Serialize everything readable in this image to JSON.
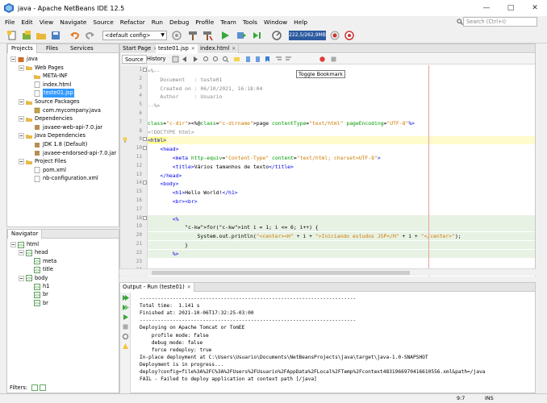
{
  "window": {
    "title": "java - Apache NetBeans IDE 12.5"
  },
  "menu": [
    "File",
    "Edit",
    "View",
    "Navigate",
    "Source",
    "Refactor",
    "Run",
    "Debug",
    "Profile",
    "Team",
    "Tools",
    "Window",
    "Help"
  ],
  "search": {
    "placeholder": "Search (Ctrl+I)"
  },
  "toolbar": {
    "config": "<default config>",
    "memory": "222,5/262,9MB"
  },
  "projects_panel": {
    "tabs": [
      "Projects",
      "Files",
      "Services"
    ],
    "tree": [
      {
        "label": "java",
        "indent": 0
      },
      {
        "label": "Web Pages",
        "indent": 1
      },
      {
        "label": "META-INF",
        "indent": 2
      },
      {
        "label": "index.html",
        "indent": 2
      },
      {
        "label": "teste01.jsp",
        "indent": 2,
        "selected": true
      },
      {
        "label": "Source Packages",
        "indent": 1
      },
      {
        "label": "com.mycompany.java",
        "indent": 2
      },
      {
        "label": "Dependencies",
        "indent": 1
      },
      {
        "label": "javaee-web-api-7.0.jar",
        "indent": 2
      },
      {
        "label": "Java Dependencies",
        "indent": 1
      },
      {
        "label": "JDK 1.8 (Default)",
        "indent": 2
      },
      {
        "label": "javaee-endorsed-api-7.0.jar",
        "indent": 2
      },
      {
        "label": "Project Files",
        "indent": 1
      },
      {
        "label": "pom.xml",
        "indent": 2
      },
      {
        "label": "nb-configuration.xml",
        "indent": 2
      }
    ]
  },
  "navigator": {
    "title": "Navigator",
    "tree": [
      {
        "label": "html",
        "indent": 0
      },
      {
        "label": "head",
        "indent": 1
      },
      {
        "label": "meta",
        "indent": 2
      },
      {
        "label": "title",
        "indent": 2
      },
      {
        "label": "body",
        "indent": 1
      },
      {
        "label": "h1",
        "indent": 2
      },
      {
        "label": "br",
        "indent": 2
      },
      {
        "label": "br",
        "indent": 2
      }
    ],
    "filters_label": "Filters:"
  },
  "editor": {
    "tabs": [
      "Start Page",
      "teste01.jsp",
      "index.html"
    ],
    "view_buttons": [
      "Source",
      "History"
    ],
    "tooltip": "Toggle Bookmark",
    "lines": [
      {
        "n": "1",
        "t": "<%--"
      },
      {
        "n": "2",
        "t": "    Document   : teste01"
      },
      {
        "n": "3",
        "t": "    Created on : 06/10/2021, 16:18:04"
      },
      {
        "n": "4",
        "t": "    Author     : Usuario"
      },
      {
        "n": "5",
        "t": "--%>"
      },
      {
        "n": "6",
        "t": ""
      },
      {
        "n": "7",
        "t": "<%@page contentType=\"text/html\" pageEncoding=\"UTF-8\"%>"
      },
      {
        "n": "8",
        "t": "<!DOCTYPE html>"
      },
      {
        "n": "9",
        "t": "<html>"
      },
      {
        "n": "10",
        "t": "    <head>"
      },
      {
        "n": "11",
        "t": "        <meta http-equiv=\"Content-Type\" content=\"text/html; charset=UTF-8\">"
      },
      {
        "n": "12",
        "t": "        <title>Vários tamanhos de texto</title>"
      },
      {
        "n": "13",
        "t": "    </head>"
      },
      {
        "n": "14",
        "t": "    <body>"
      },
      {
        "n": "15",
        "t": "        <h1>Hello World!</h1>"
      },
      {
        "n": "16",
        "t": "        <br><br>"
      },
      {
        "n": "17",
        "t": ""
      },
      {
        "n": "18",
        "t": "        <%"
      },
      {
        "n": "19",
        "t": "            for(int i = 1; i <= 6; i++) {"
      },
      {
        "n": "20",
        "t": "                System.out.println(\"<center><H\" + i + \">Iniciando estudos JSP</H\" + i + \"</center>\");"
      },
      {
        "n": "21",
        "t": "            }"
      },
      {
        "n": "22",
        "t": "        %>"
      },
      {
        "n": "23",
        "t": ""
      },
      {
        "n": "24",
        "t": "    </body>"
      }
    ]
  },
  "output": {
    "tab": "Output - Run (teste01)",
    "lines": [
      "------------------------------------------------------------------------",
      "Total time:  1.141 s",
      "Finished at: 2021-10-06T17:32:25-03:00",
      "------------------------------------------------------------------------",
      "Deploying on Apache Tomcat or TomEE",
      "    profile mode: false",
      "    debug mode: false",
      "    force redeploy: true",
      "In-place deployment at C:\\Users\\Usuario\\Documents\\NetBeansProjects\\java\\target\\java-1.0-SNAPSHOT",
      "Deployment is in progress...",
      "deploy?config=file%3A%2FC%3A%2FUsers%2FUsuario%2FAppData%2FLocal%2FTemp%2Fcontext4831966970416610556.xml&path=/java",
      "FAIL - Failed to deploy application at context path [/java]"
    ]
  },
  "status": {
    "position": "9:7",
    "mode": "INS"
  }
}
